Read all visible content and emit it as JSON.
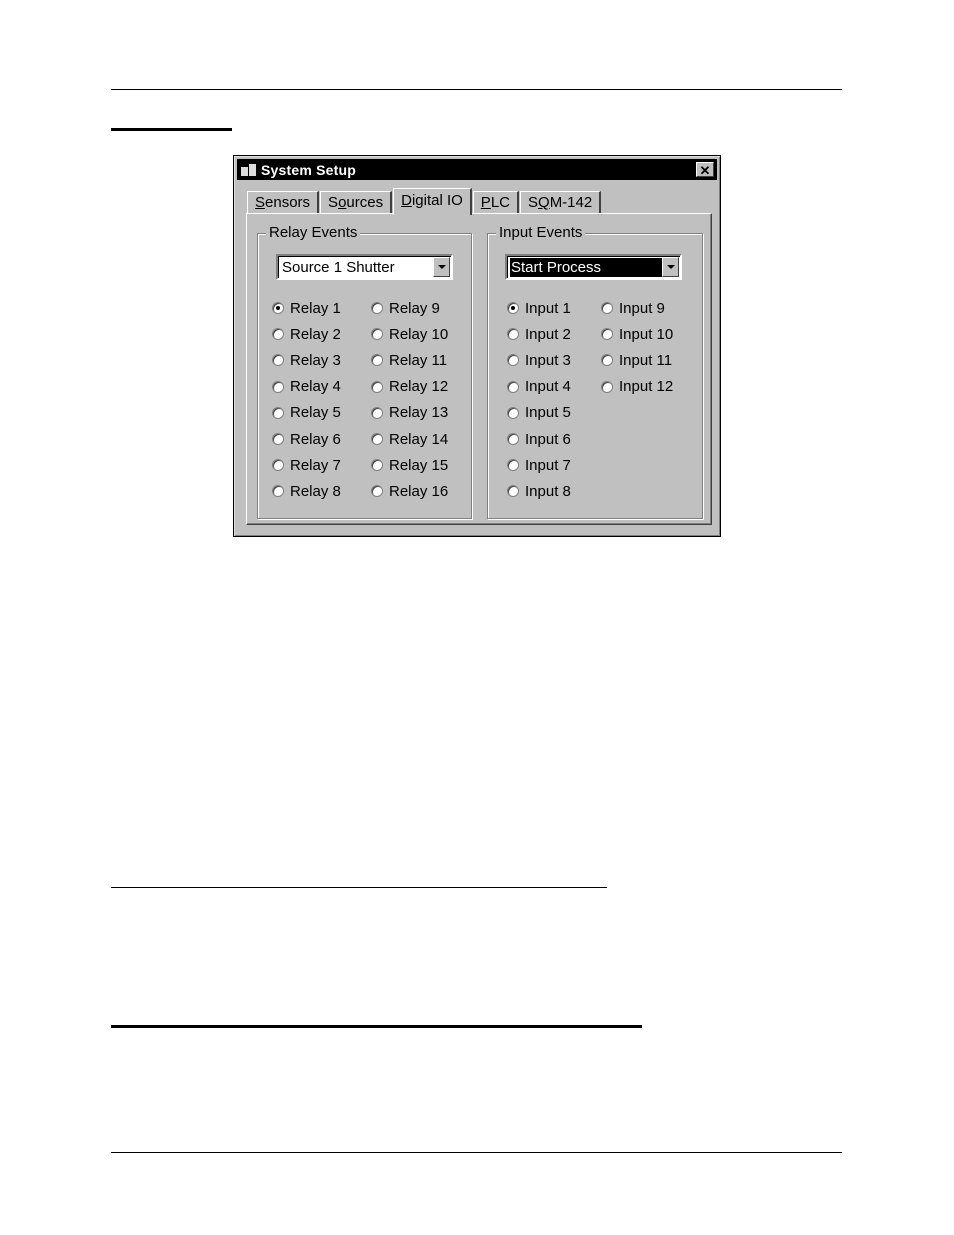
{
  "dialog": {
    "title": "System Setup",
    "close_label": "✕",
    "tabs": [
      {
        "label": "Sensors",
        "accel": "S",
        "rest": "ensors",
        "active": false
      },
      {
        "label": "Sources",
        "pre": "S",
        "accel": "o",
        "rest": "urces",
        "active": false
      },
      {
        "label": "Digital IO",
        "accel": "D",
        "rest": "igital IO",
        "active": true
      },
      {
        "label": "PLC",
        "accel": "P",
        "rest": "LC",
        "active": false
      },
      {
        "label": "SQM-142",
        "pre": "S",
        "accel": "Q",
        "rest": "M-142",
        "active": false
      }
    ],
    "relay_events": {
      "label": "Relay Events",
      "selected": "Source 1 Shutter",
      "options": [
        "Relay 1",
        "Relay 2",
        "Relay 3",
        "Relay 4",
        "Relay 5",
        "Relay 6",
        "Relay 7",
        "Relay 8",
        "Relay 9",
        "Relay 10",
        "Relay 11",
        "Relay 12",
        "Relay 13",
        "Relay 14",
        "Relay 15",
        "Relay 16"
      ],
      "checked": "Relay 1"
    },
    "input_events": {
      "label": "Input Events",
      "selected": "Start Process",
      "options": [
        "Input 1",
        "Input 2",
        "Input 3",
        "Input 4",
        "Input 5",
        "Input 6",
        "Input 7",
        "Input 8",
        "Input 9",
        "Input 10",
        "Input 11",
        "Input 12"
      ],
      "checked": "Input 1"
    }
  }
}
